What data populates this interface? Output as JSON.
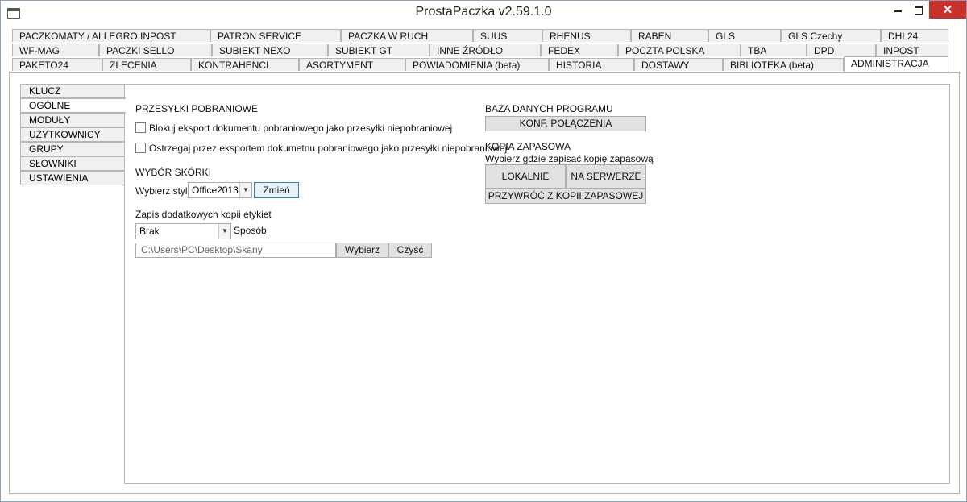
{
  "window": {
    "title": "ProstaPaczka v2.59.1.0",
    "close_glyph": "✕"
  },
  "tabs_row1": [
    "PACZKOMATY / ALLEGRO INPOST",
    "PATRON SERVICE",
    "PACZKA W RUCH",
    "SUUS",
    "RHENUS",
    "RABEN",
    "GLS",
    "GLS Czechy",
    "DHL24"
  ],
  "tabs_row2": [
    "WF-MAG",
    "PACZKI SELLO",
    "SUBIEKT NEXO",
    "SUBIEKT GT",
    "INNE ŹRÓDŁO",
    "FEDEX",
    "POCZTA POLSKA",
    "TBA",
    "DPD",
    "INPOST"
  ],
  "tabs_row3": [
    "PAKETO24",
    "ZLECENIA",
    "KONTRAHENCI",
    "ASORTYMENT",
    "POWIADOMIENIA (beta)",
    "HISTORIA",
    "DOSTAWY",
    "BIBLIOTEKA (beta)",
    "ADMINISTRACJA"
  ],
  "active_main_tab": "ADMINISTRACJA",
  "side_tabs": [
    "KLUCZ",
    "OGÓLNE",
    "MODUŁY",
    "UŻYTKOWNICY",
    "GRUPY UPRAWNIEŃ",
    "SŁOWNIKI",
    "USTAWIENIA"
  ],
  "active_side_tab": "OGÓLNE",
  "cod": {
    "heading": "PRZESYŁKI POBRANIOWE",
    "checkbox1": "Blokuj eksport dokumentu pobraniowego jako przesyłki niepobraniowej",
    "checkbox2": "Ostrzegaj przez eksportem dokumetnu pobraniowego jako przesyłki niepobraniowej"
  },
  "skin": {
    "heading": "WYBÓR SKÓRKI",
    "label": "Wybierz styl:",
    "value": "Office2013",
    "button": "Zmień"
  },
  "labels_copy": {
    "heading": "Zapis dodatkowych kopii etykiet",
    "select_value": "Brak",
    "select_label": "Sposób",
    "path": "C:\\Users\\PC\\Desktop\\Skany",
    "choose_button": "Wybierz",
    "clear_button": "Czyść"
  },
  "database": {
    "heading": "BAZA DANYCH PROGRAMU",
    "button": "KONF. POŁĄCZENIA"
  },
  "backup": {
    "heading": "KOPIA ZAPASOWA",
    "subtitle": "Wybierz gdzie zapisać kopię zapasową",
    "local_button": "LOKALNIE",
    "server_button": "NA SERWERZE",
    "restore_button": "PRZYWRÓĆ Z KOPII ZAPASOWEJ"
  }
}
